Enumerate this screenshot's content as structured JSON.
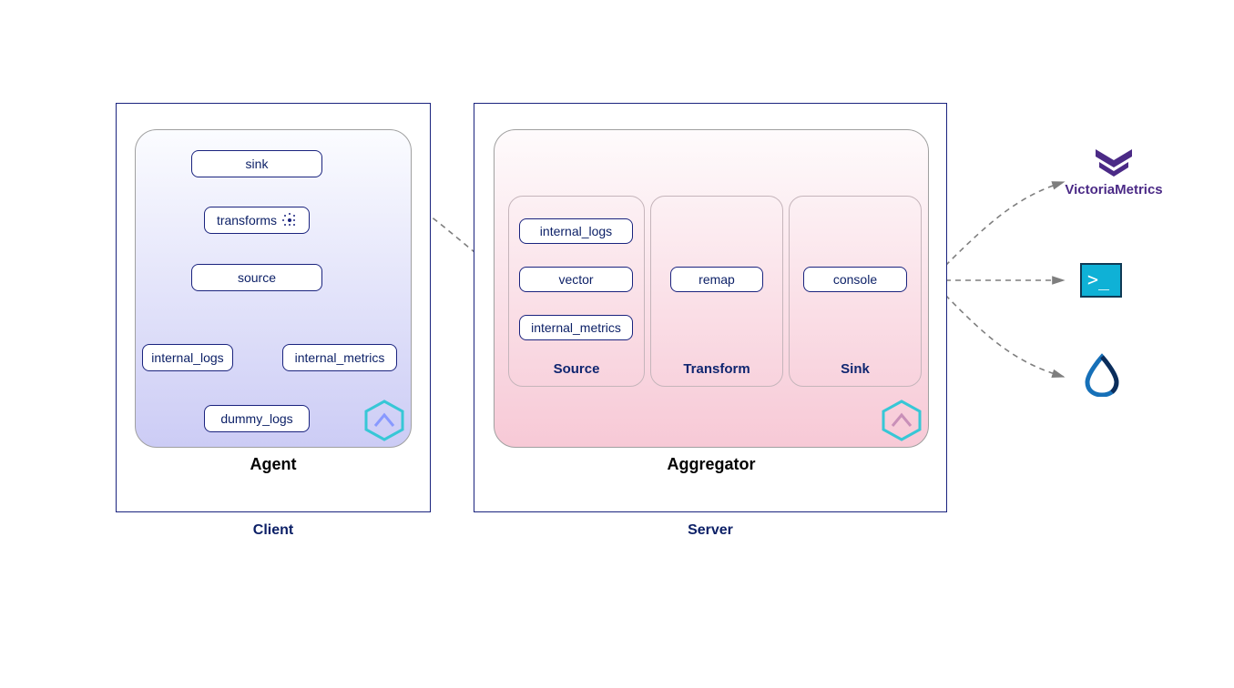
{
  "client": {
    "label": "Client",
    "agent": {
      "label": "Agent",
      "nodes": {
        "sink": "sink",
        "transforms": "transforms",
        "source": "source",
        "internal_logs": "internal_logs",
        "internal_metrics": "internal_metrics",
        "dummy_logs": "dummy_logs"
      }
    }
  },
  "server": {
    "label": "Server",
    "aggregator": {
      "label": "Aggregator",
      "sections": {
        "source": {
          "label": "Source",
          "nodes": {
            "internal_logs": "internal_logs",
            "vector": "vector",
            "internal_metrics": "internal_metrics"
          }
        },
        "transform": {
          "label": "Transform",
          "nodes": {
            "remap": "remap"
          }
        },
        "sink": {
          "label": "Sink",
          "nodes": {
            "console": "console"
          }
        }
      }
    }
  },
  "destinations": {
    "victoriametrics": "VictoriaMetrics"
  },
  "colors": {
    "outline": "#1a237e",
    "text": "#0b1f66",
    "agent_gradient_start": "#fbfcff",
    "agent_gradient_end": "#ccccf5",
    "aggregator_gradient_start": "#fefbfc",
    "aggregator_gradient_end": "#f7c9d6",
    "dash": "#7e7e7e"
  }
}
